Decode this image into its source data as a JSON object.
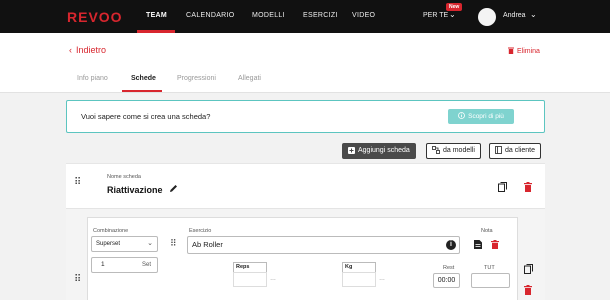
{
  "nav": {
    "logo": "REVOO",
    "items": [
      "TEAM",
      "CALENDARIO",
      "MODELLI",
      "ESERCIZI",
      "VIDEO"
    ],
    "per_te": "PER TE",
    "badge": "New",
    "user": "Andrea",
    "accent": "#d8262e"
  },
  "header": {
    "back": "Indietro",
    "delete": "Elimina",
    "tabs": [
      "Info piano",
      "Schede",
      "Progressioni",
      "Allegati"
    ],
    "active_tab": "Schede"
  },
  "banner": {
    "text": "Vuoi sapere come si crea una scheda?",
    "button": "Scopri di più",
    "border_color": "#5cc5c0"
  },
  "actions": {
    "add": "Aggiungi scheda",
    "from_models": "da modelli",
    "from_client": "da cliente"
  },
  "scheda": {
    "name_label": "Nome scheda",
    "name": "Riattivazione"
  },
  "exercise": {
    "combination_label": "Combinazione",
    "combination_value": "Superset",
    "sets_value": "1",
    "sets_label": "Set",
    "exercise_label": "Esercizio",
    "exercise_value": "Ab Roller",
    "note_label": "Nota",
    "reps_label": "Reps",
    "kg_label": "Kg",
    "rest_label": "Rest",
    "rest_value": "00:00",
    "tut_label": "TUT"
  }
}
